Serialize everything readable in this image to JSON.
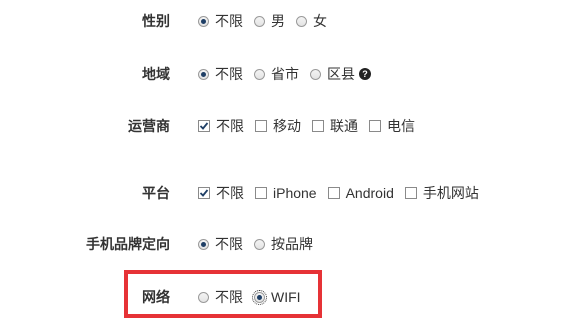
{
  "gender": {
    "label": "性别",
    "options": [
      {
        "text": "不限",
        "selected": true
      },
      {
        "text": "男",
        "selected": false
      },
      {
        "text": "女",
        "selected": false
      }
    ]
  },
  "region": {
    "label": "地域",
    "options": [
      {
        "text": "不限",
        "selected": true
      },
      {
        "text": "省市",
        "selected": false
      },
      {
        "text": "区县",
        "selected": false
      }
    ],
    "help_icon": "question-circle"
  },
  "carrier": {
    "label": "运营商",
    "options": [
      {
        "text": "不限",
        "checked": true
      },
      {
        "text": "移动",
        "checked": false
      },
      {
        "text": "联通",
        "checked": false
      },
      {
        "text": "电信",
        "checked": false
      }
    ]
  },
  "platform": {
    "label": "平台",
    "options": [
      {
        "text": "不限",
        "checked": true
      },
      {
        "text": "iPhone",
        "checked": false
      },
      {
        "text": "Android",
        "checked": false
      },
      {
        "text": "手机网站",
        "checked": false
      }
    ]
  },
  "brand_targeting": {
    "label": "手机品牌定向",
    "options": [
      {
        "text": "不限",
        "selected": true
      },
      {
        "text": "按品牌",
        "selected": false
      }
    ]
  },
  "network": {
    "label": "网络",
    "options": [
      {
        "text": "不限",
        "selected": false
      },
      {
        "text": "WIFI",
        "selected": true
      }
    ],
    "highlight_color": "#e63236"
  },
  "colors": {
    "accent": "#1f3f66",
    "highlight": "#e63236"
  }
}
